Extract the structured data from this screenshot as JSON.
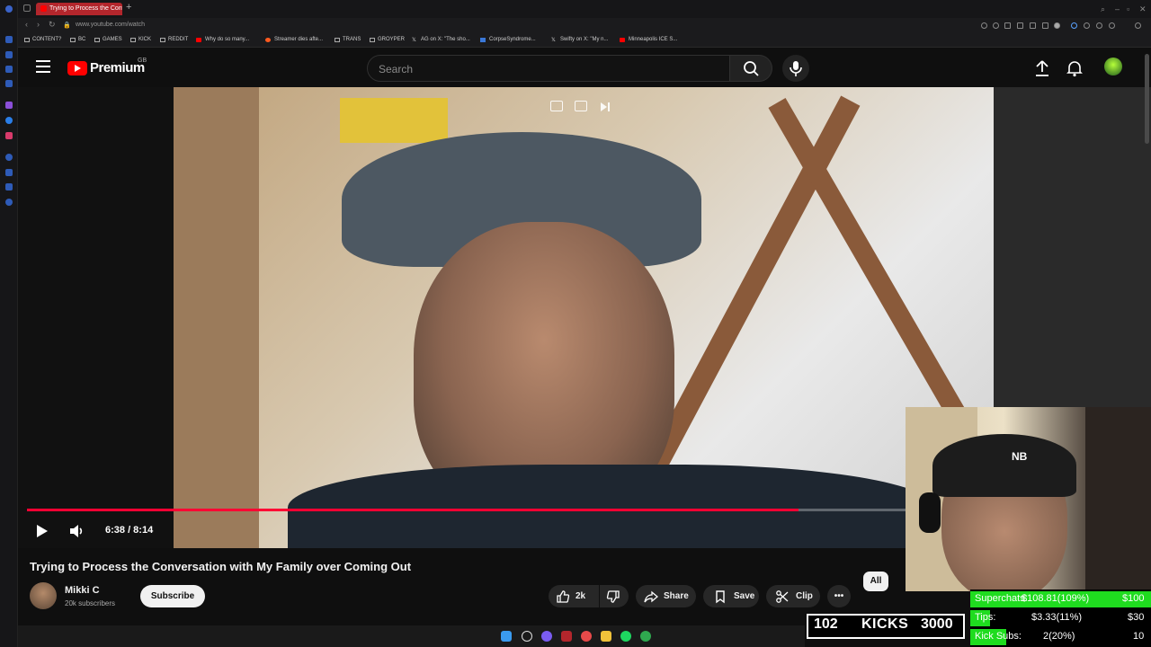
{
  "browser": {
    "tab_title": "Trying to Process the Conv",
    "new_tab_symbol": "+",
    "address": "www.youtube.com/watch",
    "bookmarks": [
      "CONTENT?",
      "BC",
      "GAMES",
      "KICK",
      "REDDIT",
      "Why do so many...",
      "Streamer dies afte...",
      "TRANS",
      "GROYPER",
      "AG on X: \"The sho...",
      "CorpseSyndrome...",
      "Swifty on X: \"My n...",
      "Minneapolis ICE S..."
    ]
  },
  "masthead": {
    "brand": "Premium",
    "country": "GB",
    "search_placeholder": "Search"
  },
  "player": {
    "current_time": "6:38",
    "duration": "8:14",
    "time_display": "6:38 / 8:14",
    "progress": 0.806,
    "accent": "#ff0033"
  },
  "video": {
    "title": "Trying to Process the Conversation with My Family over Coming Out",
    "channel": "Mikki C",
    "subscribers": "20k subscribers",
    "subscribe_label": "Subscribe",
    "likes": "2k",
    "share_label": "Share",
    "save_label": "Save",
    "clip_label": "Clip",
    "more_label": "•••"
  },
  "chips": {
    "all_label": "All"
  },
  "stream_overlay": {
    "kicks_count": "102",
    "kicks_label": "KICKS",
    "kicks_goal": "3000",
    "rows": [
      {
        "label": "Superchats:",
        "value": "$108.81(109%)",
        "goal": "$100",
        "fill": 1.0
      },
      {
        "label": "Tips:",
        "value": "$3.33(11%)",
        "goal": "$30",
        "fill": 0.11
      },
      {
        "label": "Kick Subs:",
        "value": "2(20%)",
        "goal": "10",
        "fill": 0.2
      }
    ],
    "bar_color": "#1fdc1f"
  },
  "icons": [
    "menu-icon",
    "youtube-logo-icon",
    "search-icon",
    "mic-icon",
    "upload-icon",
    "bell-icon",
    "play-icon",
    "volume-icon",
    "like-icon",
    "dislike-icon",
    "share-icon",
    "save-icon",
    "clip-icon",
    "more-icon"
  ]
}
